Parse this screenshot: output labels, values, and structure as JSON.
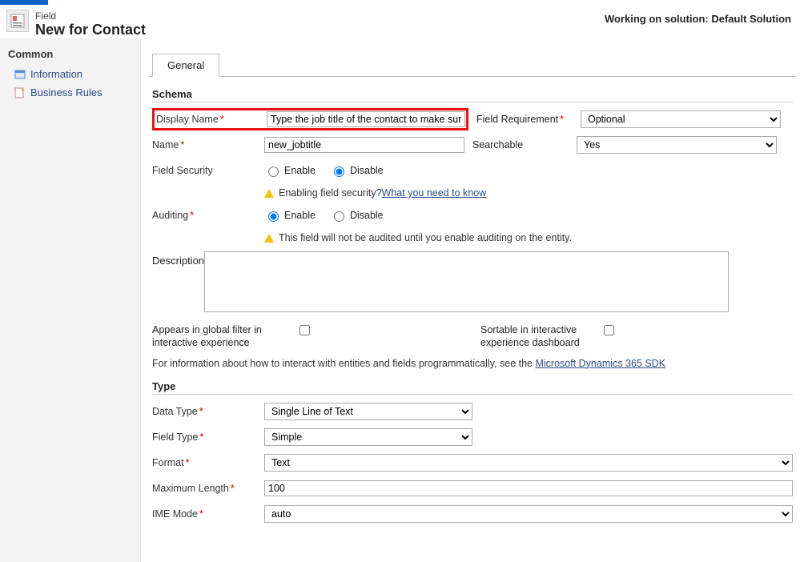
{
  "header": {
    "entity_label": "Field",
    "page_title": "New for Contact",
    "solution_text": "Working on solution: Default Solution"
  },
  "sidebar": {
    "header": "Common",
    "items": [
      {
        "label": "Information"
      },
      {
        "label": "Business Rules"
      }
    ]
  },
  "tabs": {
    "general": "General"
  },
  "schema": {
    "section_title": "Schema",
    "display_name_label": "Display Name",
    "display_name_value": "Type the job title of the contact to make sure the",
    "field_requirement_label": "Field Requirement",
    "field_requirement_value": "Optional",
    "name_label": "Name",
    "name_value": "new_jobtitle",
    "searchable_label": "Searchable",
    "searchable_value": "Yes",
    "field_security_label": "Field Security",
    "enable_label": "Enable",
    "disable_label": "Disable",
    "security_hint_pre": "Enabling field security? ",
    "security_hint_link": "What you need to know",
    "auditing_label": "Auditing",
    "auditing_hint": "This field will not be audited until you enable auditing on the entity.",
    "description_label": "Description",
    "description_value": "",
    "global_filter_label": "Appears in global filter in interactive experience",
    "sortable_label": "Sortable in interactive experience dashboard",
    "info_note_pre": "For information about how to interact with entities and fields programmatically, see the ",
    "info_note_link": "Microsoft Dynamics 365 SDK"
  },
  "type": {
    "section_title": "Type",
    "data_type_label": "Data Type",
    "data_type_value": "Single Line of Text",
    "field_type_label": "Field Type",
    "field_type_value": "Simple",
    "format_label": "Format",
    "format_value": "Text",
    "max_length_label": "Maximum Length",
    "max_length_value": "100",
    "ime_mode_label": "IME Mode",
    "ime_mode_value": "auto"
  }
}
